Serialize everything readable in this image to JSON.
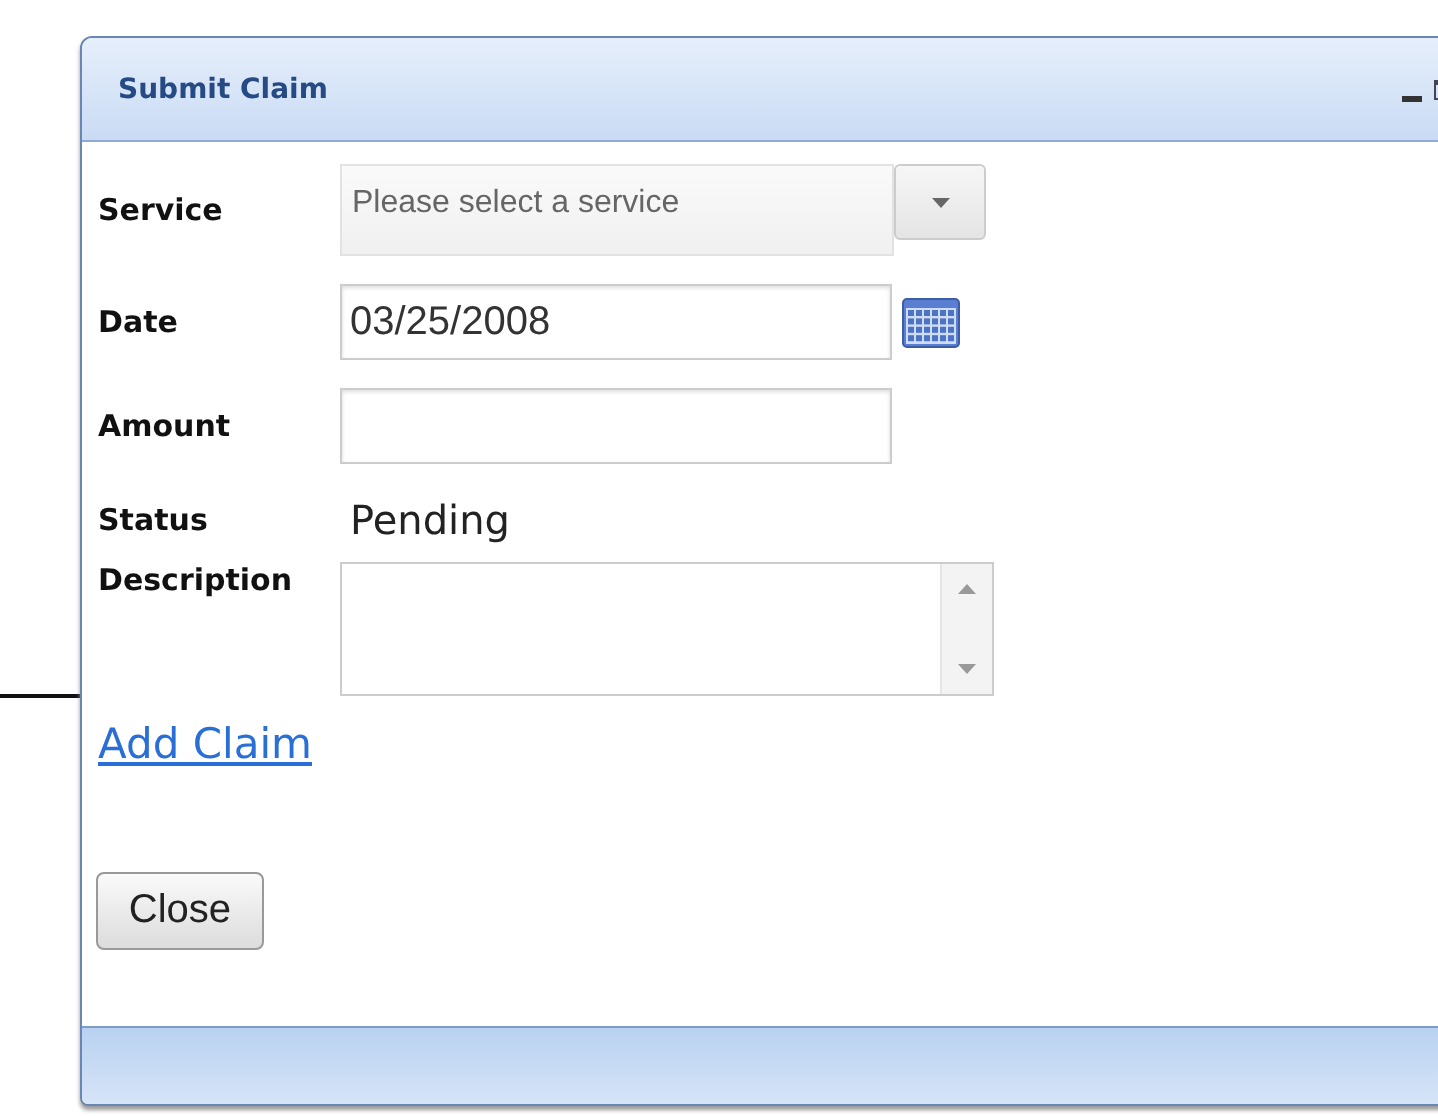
{
  "window": {
    "title": "Submit Claim"
  },
  "fields": [
    {
      "kind": "select",
      "label": "Service",
      "placeholder": "Please select a service"
    },
    {
      "kind": "date",
      "label": "Date",
      "value": "03/25/2008"
    },
    {
      "kind": "text",
      "label": "Amount"
    },
    {
      "kind": "static",
      "label": "Status",
      "value": "Pending"
    },
    {
      "kind": "textarea",
      "label": "Description"
    }
  ],
  "link": "Add Claim",
  "buttons": [
    "Close"
  ]
}
